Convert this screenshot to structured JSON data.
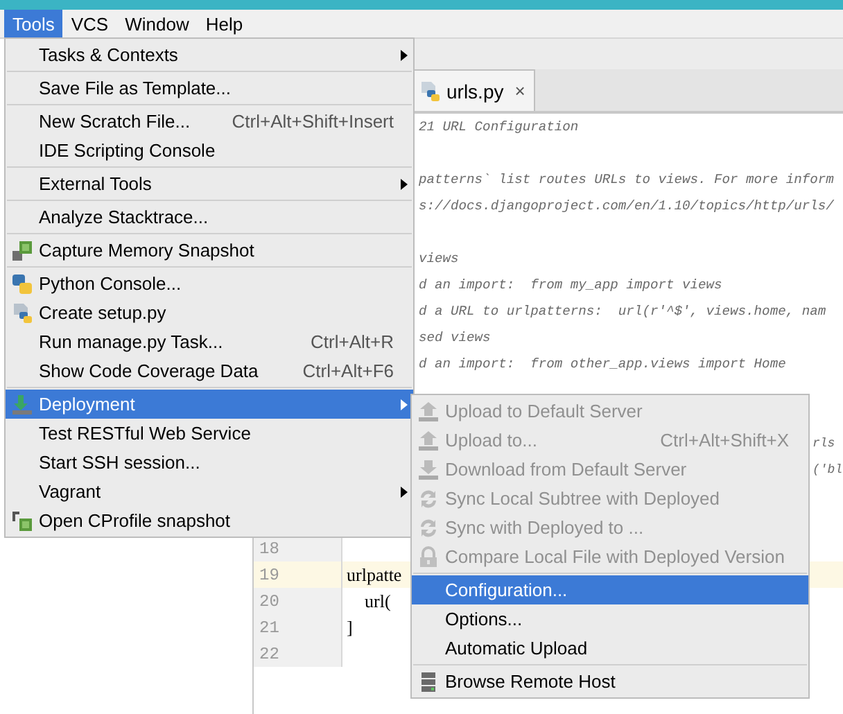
{
  "menubar": [
    {
      "label": "Tools",
      "selected": true
    },
    {
      "label": "VCS",
      "selected": false
    },
    {
      "label": "Window",
      "selected": false
    },
    {
      "label": "Help",
      "selected": false
    }
  ],
  "tools_menu": {
    "groups": [
      {
        "items": [
          {
            "label": "Tasks & Contexts",
            "submenu": true,
            "selected": false
          }
        ]
      },
      {
        "items": [
          {
            "label": "Save File as Template...",
            "submenu": false,
            "selected": false
          }
        ]
      },
      {
        "items": [
          {
            "label": "New Scratch File...",
            "shortcut": "Ctrl+Alt+Shift+Insert",
            "submenu": false,
            "selected": false
          },
          {
            "label": "IDE Scripting Console",
            "submenu": false,
            "selected": false
          }
        ]
      },
      {
        "items": [
          {
            "label": "External Tools",
            "submenu": true,
            "selected": false
          }
        ]
      },
      {
        "items": [
          {
            "label": "Analyze Stacktrace...",
            "submenu": false,
            "selected": false
          }
        ]
      },
      {
        "items": [
          {
            "label": "Capture Memory Snapshot",
            "submenu": false,
            "selected": false
          }
        ]
      },
      {
        "items": [
          {
            "label": "Python Console...",
            "submenu": false,
            "selected": false
          },
          {
            "label": "Create setup.py",
            "submenu": false,
            "selected": false
          },
          {
            "label": "Run manage.py Task...",
            "shortcut": "Ctrl+Alt+R",
            "submenu": false,
            "selected": false
          },
          {
            "label": "Show Code Coverage Data",
            "shortcut": "Ctrl+Alt+F6",
            "submenu": false,
            "selected": false
          }
        ]
      },
      {
        "items": [
          {
            "label": "Deployment",
            "submenu": true,
            "selected": true
          },
          {
            "label": "Test RESTful Web Service",
            "submenu": false,
            "selected": false
          },
          {
            "label": "Start SSH session...",
            "submenu": false,
            "selected": false
          },
          {
            "label": "Vagrant",
            "submenu": true,
            "selected": false
          },
          {
            "label": "Open CProfile snapshot",
            "submenu": false,
            "selected": false
          }
        ]
      }
    ]
  },
  "deployment_submenu": {
    "groups": [
      {
        "items": [
          {
            "label": "Upload to Default Server",
            "disabled": true,
            "selected": false
          },
          {
            "label": "Upload to...",
            "shortcut": "Ctrl+Alt+Shift+X",
            "disabled": true,
            "selected": false
          },
          {
            "label": "Download from Default Server",
            "disabled": true,
            "selected": false
          },
          {
            "label": "Sync Local Subtree with Deployed",
            "disabled": true,
            "selected": false
          },
          {
            "label": "Sync with Deployed to ...",
            "disabled": true,
            "selected": false
          },
          {
            "label": "Compare Local File with Deployed Version",
            "disabled": true,
            "selected": false
          }
        ]
      },
      {
        "items": [
          {
            "label": "Configuration...",
            "disabled": false,
            "selected": true
          },
          {
            "label": "Options...",
            "disabled": false,
            "selected": false
          },
          {
            "label": "Automatic Upload",
            "disabled": false,
            "selected": false
          }
        ]
      },
      {
        "items": [
          {
            "label": "Browse Remote Host",
            "disabled": false,
            "selected": false
          }
        ]
      }
    ]
  },
  "editor": {
    "tab": {
      "label": "urls.py",
      "close": "×"
    },
    "lines": [
      {
        "kind": "comment",
        "text": "21 URL Configuration",
        "current": false
      },
      {
        "kind": "blank"
      },
      {
        "kind": "comment",
        "text": "patterns` list routes URLs to views. For more inform",
        "current": false
      },
      {
        "kind": "comment",
        "text": "s://docs.djangoproject.com/en/1.10/topics/http/urls/",
        "current": false
      },
      {
        "kind": "blank"
      },
      {
        "kind": "comment",
        "text": "views",
        "current": false
      },
      {
        "kind": "comment",
        "text": "d an import:  from my_app import views",
        "current": false
      },
      {
        "kind": "comment",
        "text": "d a URL to urlpatterns:  url(r'^$', views.home, nam",
        "current": false
      },
      {
        "kind": "comment",
        "text": "sed views",
        "current": false
      },
      {
        "kind": "comment",
        "text": "d an import:  from other_app.views import Home",
        "current": false
      },
      {
        "kind": "blank"
      },
      {
        "kind": "blank"
      },
      {
        "kind": "comment_right",
        "text": "rls",
        "current": false
      },
      {
        "kind": "comment_right",
        "text": "('bl",
        "current": false
      },
      {
        "kind": "blank"
      },
      {
        "kind": "blank"
      },
      {
        "kind": "code",
        "number": "18",
        "current": false
      },
      {
        "kind": "code",
        "number": "19",
        "text": "urlpatte",
        "current": true
      },
      {
        "kind": "code",
        "number": "20",
        "text": "    url(",
        "current": false
      },
      {
        "kind": "code",
        "number": "21",
        "text": "]",
        "current": false
      },
      {
        "kind": "code",
        "number": "22",
        "current": false
      }
    ]
  }
}
